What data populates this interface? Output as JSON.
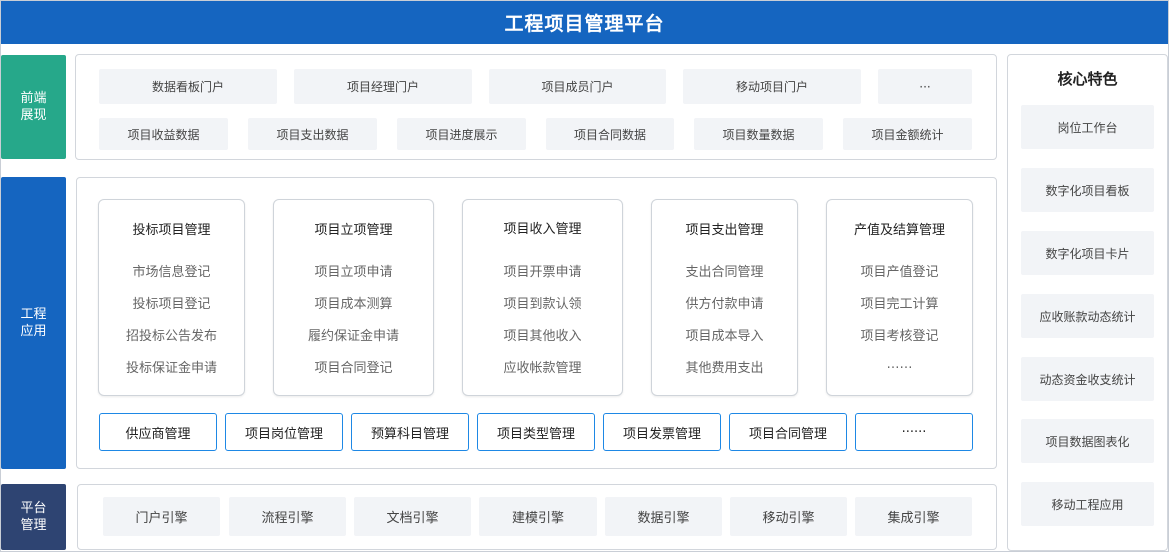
{
  "title": "工程项目管理平台",
  "sections": {
    "front": "前端展现",
    "app": "工程应用",
    "platform": "平台管理"
  },
  "front_row1": [
    "数据看板门户",
    "项目经理门户",
    "项目成员门户",
    "移动项目门户",
    "···"
  ],
  "front_row2": [
    "项目收益数据",
    "项目支出数据",
    "项目进度展示",
    "项目合同数据",
    "项目数量数据",
    "项目金额统计"
  ],
  "modules": [
    {
      "title": "投标项目管理",
      "items": [
        "市场信息登记",
        "投标项目登记",
        "招投标公告发布",
        "投标保证金申请"
      ]
    },
    {
      "title": "项目立项管理",
      "items": [
        "项目立项申请",
        "项目成本测算",
        "履约保证金申请",
        "项目合同登记"
      ]
    },
    {
      "title": "项目收入管理",
      "items": [
        "项目开票申请",
        "项目到款认领",
        "项目其他收入",
        "应收帐款管理"
      ]
    },
    {
      "title": "项目支出管理",
      "items": [
        "支出合同管理",
        "供方付款申请",
        "项目成本导入",
        "其他费用支出"
      ]
    },
    {
      "title": "产值及结算管理",
      "items": [
        "项目产值登记",
        "项目完工计算",
        "项目考核登记",
        "……"
      ]
    }
  ],
  "app_buttons": [
    "供应商管理",
    "项目岗位管理",
    "预算科目管理",
    "项目类型管理",
    "项目发票管理",
    "项目合同管理",
    "······"
  ],
  "engines": [
    "门户引擎",
    "流程引擎",
    "文档引擎",
    "建模引擎",
    "数据引擎",
    "移动引擎",
    "集成引擎"
  ],
  "core": {
    "title": "核心特色",
    "items": [
      "岗位工作台",
      "数字化项目看板",
      "数字化项目卡片",
      "应收账款动态统计",
      "动态资金收支统计",
      "项目数据图表化",
      "移动工程应用"
    ]
  }
}
